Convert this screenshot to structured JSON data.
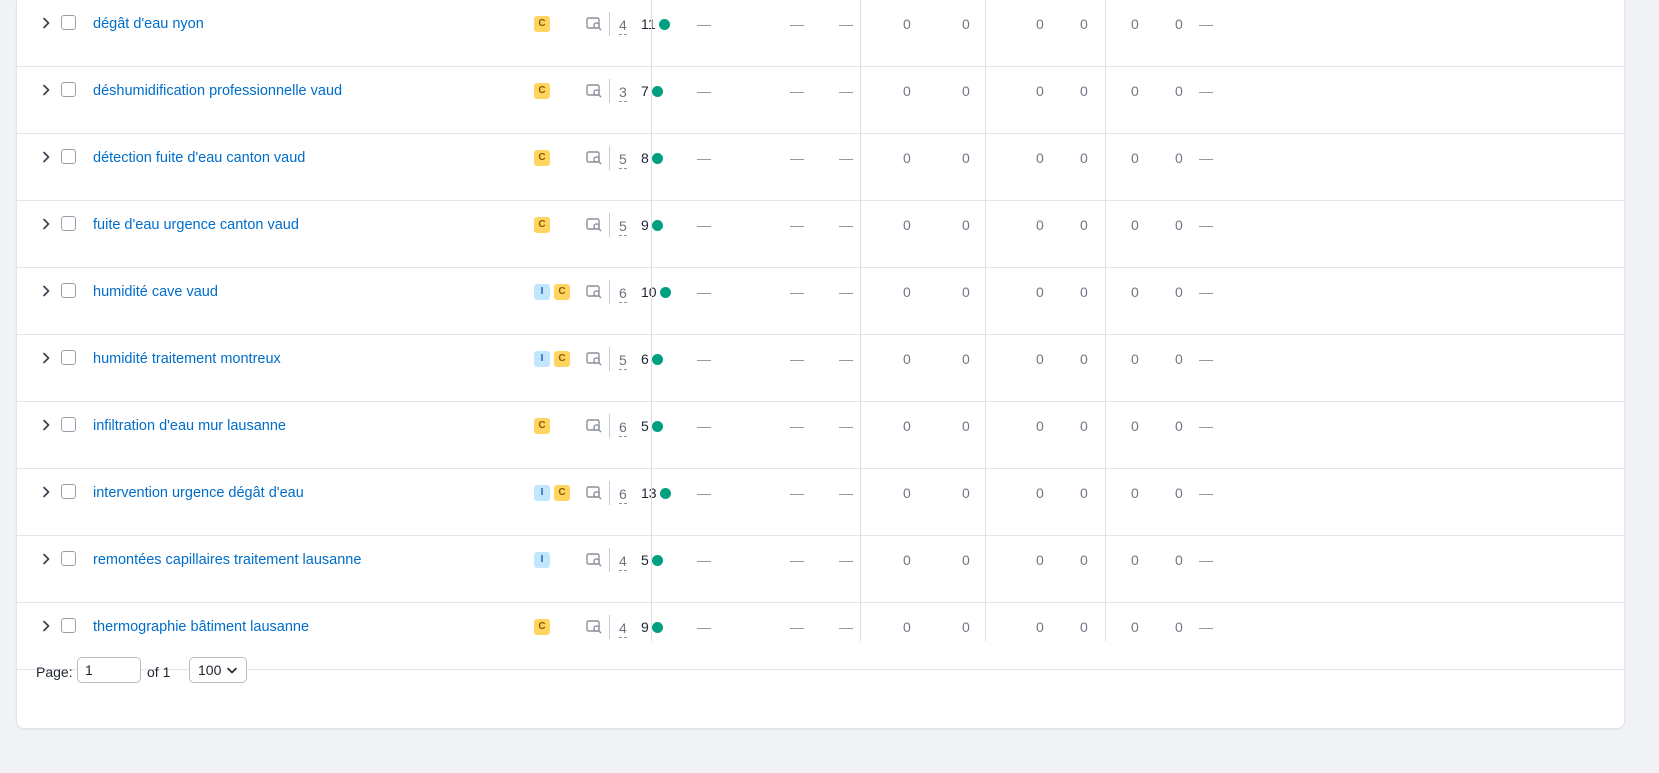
{
  "rows": [
    {
      "keyword": "dégât d'eau nyon",
      "intents": [
        "C"
      ],
      "position": "4",
      "kd": "11"
    },
    {
      "keyword": "déshumidification professionnelle vaud",
      "intents": [
        "C"
      ],
      "position": "3",
      "kd": "7"
    },
    {
      "keyword": "détection fuite d'eau canton vaud",
      "intents": [
        "C"
      ],
      "position": "5",
      "kd": "8"
    },
    {
      "keyword": "fuite d'eau urgence canton vaud",
      "intents": [
        "C"
      ],
      "position": "5",
      "kd": "9"
    },
    {
      "keyword": "humidité cave vaud",
      "intents": [
        "I",
        "C"
      ],
      "position": "6",
      "kd": "10"
    },
    {
      "keyword": "humidité traitement montreux",
      "intents": [
        "I",
        "C"
      ],
      "position": "5",
      "kd": "6"
    },
    {
      "keyword": "infiltration d'eau mur lausanne",
      "intents": [
        "C"
      ],
      "position": "6",
      "kd": "5"
    },
    {
      "keyword": "intervention urgence dégât d'eau",
      "intents": [
        "I",
        "C"
      ],
      "position": "6",
      "kd": "13"
    },
    {
      "keyword": "remontées capillaires traitement lausanne",
      "intents": [
        "I"
      ],
      "position": "4",
      "kd": "5"
    },
    {
      "keyword": "thermographie bâtiment lausanne",
      "intents": [
        "C"
      ],
      "position": "4",
      "kd": "9"
    }
  ],
  "row_metrics": {
    "dash_cols": [
      "—",
      "—",
      "—"
    ],
    "zero_cols": [
      "0",
      "0",
      "0",
      "0",
      "0",
      "0"
    ],
    "last_col": "—"
  },
  "pagination": {
    "page_label": "Page:",
    "page_value": "1",
    "of_label": "of 1",
    "per_page_value": "100"
  },
  "icons": {
    "expand": "chevron-right-icon",
    "serp": "serp-features-icon",
    "dropdown": "chevron-down-icon"
  },
  "colors": {
    "keyword_link": "#006dca",
    "kd_dot": "#009f81",
    "badge_commercial": "#ffd460",
    "badge_informational": "#c3e6ff",
    "page_bg": "#f0f2f6"
  }
}
